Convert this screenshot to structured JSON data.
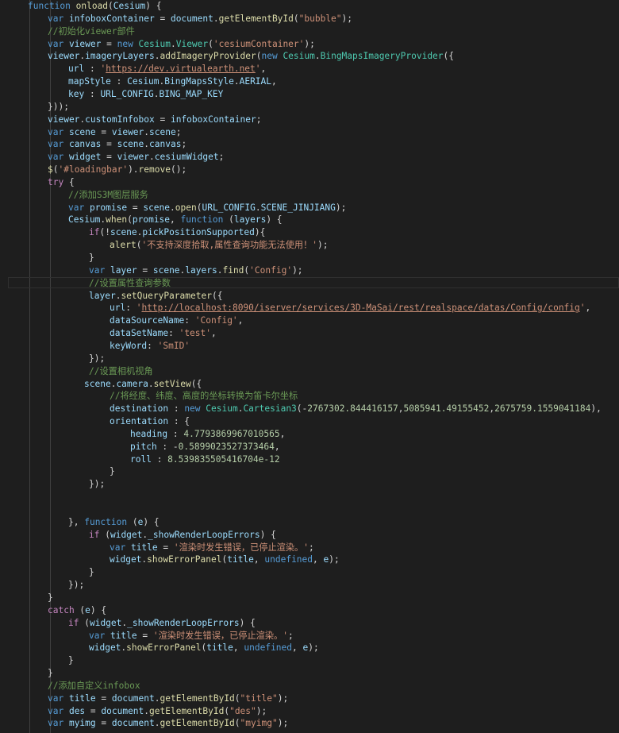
{
  "code_lines": [
    [
      [
        "kw",
        "function "
      ],
      [
        "fn",
        "onload"
      ],
      [
        "plain",
        "("
      ],
      [
        "var",
        "Cesium"
      ],
      [
        "plain",
        ") {"
      ]
    ],
    [
      [
        "kw",
        "var "
      ],
      [
        "var",
        "infoboxContainer"
      ],
      [
        "plain",
        " = "
      ],
      [
        "var",
        "document"
      ],
      [
        "plain",
        "."
      ],
      [
        "fn",
        "getElementById"
      ],
      [
        "plain",
        "("
      ],
      [
        "str",
        "\"bubble\""
      ],
      [
        "plain",
        ");"
      ]
    ],
    [
      [
        "cmt",
        "//初始化viewer部件"
      ]
    ],
    [
      [
        "kw",
        "var "
      ],
      [
        "var",
        "viewer"
      ],
      [
        "plain",
        " = "
      ],
      [
        "kw",
        "new "
      ],
      [
        "cls",
        "Cesium"
      ],
      [
        "plain",
        "."
      ],
      [
        "cls",
        "Viewer"
      ],
      [
        "plain",
        "("
      ],
      [
        "str",
        "'cesiumContainer'"
      ],
      [
        "plain",
        ");"
      ]
    ],
    [
      [
        "var",
        "viewer"
      ],
      [
        "plain",
        "."
      ],
      [
        "var",
        "imageryLayers"
      ],
      [
        "plain",
        "."
      ],
      [
        "fn",
        "addImageryProvider"
      ],
      [
        "plain",
        "("
      ],
      [
        "kw",
        "new "
      ],
      [
        "cls",
        "Cesium"
      ],
      [
        "plain",
        "."
      ],
      [
        "cls",
        "BingMapsImageryProvider"
      ],
      [
        "plain",
        "({"
      ]
    ],
    [
      [
        "var",
        "url"
      ],
      [
        "plain",
        " : "
      ],
      [
        "str",
        "'"
      ],
      [
        "link",
        "https://dev.virtualearth.net"
      ],
      [
        "str",
        "'"
      ],
      [
        "plain",
        ","
      ]
    ],
    [
      [
        "var",
        "mapStyle"
      ],
      [
        "plain",
        " : "
      ],
      [
        "var",
        "Cesium"
      ],
      [
        "plain",
        "."
      ],
      [
        "var",
        "BingMapsStyle"
      ],
      [
        "plain",
        "."
      ],
      [
        "var",
        "AERIAL"
      ],
      [
        "plain",
        ","
      ]
    ],
    [
      [
        "var",
        "key"
      ],
      [
        "plain",
        " : "
      ],
      [
        "var",
        "URL_CONFIG"
      ],
      [
        "plain",
        "."
      ],
      [
        "var",
        "BING_MAP_KEY"
      ]
    ],
    [
      [
        "plain",
        "}));"
      ]
    ],
    [
      [
        "var",
        "viewer"
      ],
      [
        "plain",
        "."
      ],
      [
        "var",
        "customInfobox"
      ],
      [
        "plain",
        " = "
      ],
      [
        "var",
        "infoboxContainer"
      ],
      [
        "plain",
        ";"
      ]
    ],
    [
      [
        "kw",
        "var "
      ],
      [
        "var",
        "scene"
      ],
      [
        "plain",
        " = "
      ],
      [
        "var",
        "viewer"
      ],
      [
        "plain",
        "."
      ],
      [
        "var",
        "scene"
      ],
      [
        "plain",
        ";"
      ]
    ],
    [
      [
        "kw",
        "var "
      ],
      [
        "var",
        "canvas"
      ],
      [
        "plain",
        " = "
      ],
      [
        "var",
        "scene"
      ],
      [
        "plain",
        "."
      ],
      [
        "var",
        "canvas"
      ],
      [
        "plain",
        ";"
      ]
    ],
    [
      [
        "kw",
        "var "
      ],
      [
        "var",
        "widget"
      ],
      [
        "plain",
        " = "
      ],
      [
        "var",
        "viewer"
      ],
      [
        "plain",
        "."
      ],
      [
        "var",
        "cesiumWidget"
      ],
      [
        "plain",
        ";"
      ]
    ],
    [
      [
        "fn",
        "$"
      ],
      [
        "plain",
        "("
      ],
      [
        "str",
        "'#loadingbar'"
      ],
      [
        "plain",
        ")."
      ],
      [
        "fn",
        "remove"
      ],
      [
        "plain",
        "();"
      ]
    ],
    [
      [
        "ctl",
        "try "
      ],
      [
        "plain",
        "{"
      ]
    ],
    [
      [
        "cmt",
        "//添加S3M图层服务"
      ]
    ],
    [
      [
        "kw",
        "var "
      ],
      [
        "var",
        "promise"
      ],
      [
        "plain",
        " = "
      ],
      [
        "var",
        "scene"
      ],
      [
        "plain",
        "."
      ],
      [
        "fn",
        "open"
      ],
      [
        "plain",
        "("
      ],
      [
        "var",
        "URL_CONFIG"
      ],
      [
        "plain",
        "."
      ],
      [
        "var",
        "SCENE_JINJIANG"
      ],
      [
        "plain",
        ");"
      ]
    ],
    [
      [
        "var",
        "Cesium"
      ],
      [
        "plain",
        "."
      ],
      [
        "fn",
        "when"
      ],
      [
        "plain",
        "("
      ],
      [
        "var",
        "promise"
      ],
      [
        "plain",
        ", "
      ],
      [
        "kw",
        "function "
      ],
      [
        "plain",
        "("
      ],
      [
        "var",
        "layers"
      ],
      [
        "plain",
        ") {"
      ]
    ],
    [
      [
        "ctl",
        "if"
      ],
      [
        "plain",
        "(!"
      ],
      [
        "var",
        "scene"
      ],
      [
        "plain",
        "."
      ],
      [
        "var",
        "pickPositionSupported"
      ],
      [
        "plain",
        "){"
      ]
    ],
    [
      [
        "fn",
        "alert"
      ],
      [
        "plain",
        "("
      ],
      [
        "str",
        "'不支持深度拾取,属性查询功能无法使用！'"
      ],
      [
        "plain",
        ");"
      ]
    ],
    [
      [
        "plain",
        "}"
      ]
    ],
    [
      [
        "kw",
        "var "
      ],
      [
        "var",
        "layer"
      ],
      [
        "plain",
        " = "
      ],
      [
        "var",
        "scene"
      ],
      [
        "plain",
        "."
      ],
      [
        "var",
        "layers"
      ],
      [
        "plain",
        "."
      ],
      [
        "fn",
        "find"
      ],
      [
        "plain",
        "("
      ],
      [
        "str",
        "'Config'"
      ],
      [
        "plain",
        ");"
      ]
    ],
    [
      [
        "cmt",
        "//设置属性查询参数"
      ]
    ],
    [
      [
        "var",
        "layer"
      ],
      [
        "plain",
        "."
      ],
      [
        "fn",
        "setQueryParameter"
      ],
      [
        "plain",
        "({"
      ]
    ],
    [
      [
        "var",
        "url"
      ],
      [
        "plain",
        ": "
      ],
      [
        "str",
        "'"
      ],
      [
        "link",
        "http://localhost:8090/iserver/services/3D-MaSai/rest/realspace/datas/Config/config"
      ],
      [
        "str",
        "'"
      ],
      [
        "plain",
        ","
      ]
    ],
    [
      [
        "var",
        "dataSourceName"
      ],
      [
        "plain",
        ": "
      ],
      [
        "str",
        "'Config'"
      ],
      [
        "plain",
        ","
      ]
    ],
    [
      [
        "var",
        "dataSetName"
      ],
      [
        "plain",
        ": "
      ],
      [
        "str",
        "'test'"
      ],
      [
        "plain",
        ","
      ]
    ],
    [
      [
        "var",
        "keyWord"
      ],
      [
        "plain",
        ": "
      ],
      [
        "str",
        "'SmID'"
      ]
    ],
    [
      [
        "plain",
        "});"
      ]
    ],
    [
      [
        "cmt",
        "//设置相机视角"
      ]
    ],
    [
      [
        "var",
        "scene"
      ],
      [
        "plain",
        "."
      ],
      [
        "var",
        "camera"
      ],
      [
        "plain",
        "."
      ],
      [
        "fn",
        "setView"
      ],
      [
        "plain",
        "({"
      ]
    ],
    [
      [
        "cmt",
        "//将经度、纬度、高度的坐标转换为笛卡尔坐标"
      ]
    ],
    [
      [
        "var",
        "destination"
      ],
      [
        "plain",
        " : "
      ],
      [
        "kw",
        "new "
      ],
      [
        "cls",
        "Cesium"
      ],
      [
        "plain",
        "."
      ],
      [
        "cls",
        "Cartesian3"
      ],
      [
        "plain",
        "(-"
      ],
      [
        "num",
        "2767302.844416157"
      ],
      [
        "plain",
        ","
      ],
      [
        "num",
        "5085941.49155452"
      ],
      [
        "plain",
        ","
      ],
      [
        "num",
        "2675759.1559041184"
      ],
      [
        "plain",
        "),"
      ]
    ],
    [
      [
        "var",
        "orientation"
      ],
      [
        "plain",
        " : {"
      ]
    ],
    [
      [
        "var",
        "heading"
      ],
      [
        "plain",
        " : "
      ],
      [
        "num",
        "4.7793869967010565"
      ],
      [
        "plain",
        ","
      ]
    ],
    [
      [
        "var",
        "pitch"
      ],
      [
        "plain",
        " : -"
      ],
      [
        "num",
        "0.5899023527373464"
      ],
      [
        "plain",
        ","
      ]
    ],
    [
      [
        "var",
        "roll"
      ],
      [
        "plain",
        " : "
      ],
      [
        "num",
        "8.539835505416704e-12"
      ]
    ],
    [
      [
        "plain",
        "}"
      ]
    ],
    [
      [
        "plain",
        "});"
      ]
    ],
    [],
    [],
    [
      [
        "plain",
        "}, "
      ],
      [
        "kw",
        "function "
      ],
      [
        "plain",
        "("
      ],
      [
        "var",
        "e"
      ],
      [
        "plain",
        ") {"
      ]
    ],
    [
      [
        "ctl",
        "if "
      ],
      [
        "plain",
        "("
      ],
      [
        "var",
        "widget"
      ],
      [
        "plain",
        "."
      ],
      [
        "var",
        "_showRenderLoopErrors"
      ],
      [
        "plain",
        ") {"
      ]
    ],
    [
      [
        "kw",
        "var "
      ],
      [
        "var",
        "title"
      ],
      [
        "plain",
        " = "
      ],
      [
        "str",
        "'渲染时发生错误，已停止渲染。'"
      ],
      [
        "plain",
        ";"
      ]
    ],
    [
      [
        "var",
        "widget"
      ],
      [
        "plain",
        "."
      ],
      [
        "fn",
        "showErrorPanel"
      ],
      [
        "plain",
        "("
      ],
      [
        "var",
        "title"
      ],
      [
        "plain",
        ", "
      ],
      [
        "kw",
        "undefined"
      ],
      [
        "plain",
        ", "
      ],
      [
        "var",
        "e"
      ],
      [
        "plain",
        ");"
      ]
    ],
    [
      [
        "plain",
        "}"
      ]
    ],
    [
      [
        "plain",
        "});"
      ]
    ],
    [
      [
        "plain",
        "}"
      ]
    ],
    [
      [
        "ctl",
        "catch "
      ],
      [
        "plain",
        "("
      ],
      [
        "var",
        "e"
      ],
      [
        "plain",
        ") {"
      ]
    ],
    [
      [
        "ctl",
        "if "
      ],
      [
        "plain",
        "("
      ],
      [
        "var",
        "widget"
      ],
      [
        "plain",
        "."
      ],
      [
        "var",
        "_showRenderLoopErrors"
      ],
      [
        "plain",
        ") {"
      ]
    ],
    [
      [
        "kw",
        "var "
      ],
      [
        "var",
        "title"
      ],
      [
        "plain",
        " = "
      ],
      [
        "str",
        "'渲染时发生错误，已停止渲染。'"
      ],
      [
        "plain",
        ";"
      ]
    ],
    [
      [
        "var",
        "widget"
      ],
      [
        "plain",
        "."
      ],
      [
        "fn",
        "showErrorPanel"
      ],
      [
        "plain",
        "("
      ],
      [
        "var",
        "title"
      ],
      [
        "plain",
        ", "
      ],
      [
        "kw",
        "undefined"
      ],
      [
        "plain",
        ", "
      ],
      [
        "var",
        "e"
      ],
      [
        "plain",
        ");"
      ]
    ],
    [
      [
        "plain",
        "}"
      ]
    ],
    [
      [
        "plain",
        "}"
      ]
    ],
    [
      [
        "cmt",
        "//添加自定义infobox"
      ]
    ],
    [
      [
        "kw",
        "var "
      ],
      [
        "var",
        "title"
      ],
      [
        "plain",
        " = "
      ],
      [
        "var",
        "document"
      ],
      [
        "plain",
        "."
      ],
      [
        "fn",
        "getElementById"
      ],
      [
        "plain",
        "("
      ],
      [
        "str",
        "\"title\""
      ],
      [
        "plain",
        ");"
      ]
    ],
    [
      [
        "kw",
        "var "
      ],
      [
        "var",
        "des"
      ],
      [
        "plain",
        " = "
      ],
      [
        "var",
        "document"
      ],
      [
        "plain",
        "."
      ],
      [
        "fn",
        "getElementById"
      ],
      [
        "plain",
        "("
      ],
      [
        "str",
        "\"des\""
      ],
      [
        "plain",
        ");"
      ]
    ],
    [
      [
        "kw",
        "var "
      ],
      [
        "var",
        "myimg"
      ],
      [
        "plain",
        " = "
      ],
      [
        "var",
        "document"
      ],
      [
        "plain",
        "."
      ],
      [
        "fn",
        "getElementById"
      ],
      [
        "plain",
        "("
      ],
      [
        "str",
        "\"myimg\""
      ],
      [
        "plain",
        ");"
      ]
    ]
  ],
  "colors": {
    "background": "#1e1e1e",
    "keyword": "#569cd6",
    "control": "#c586c0",
    "function": "#dcdcaa",
    "variable": "#9cdcfe",
    "string": "#ce9178",
    "number": "#b5cea8",
    "comment": "#6a9955",
    "class": "#4ec9b0"
  }
}
